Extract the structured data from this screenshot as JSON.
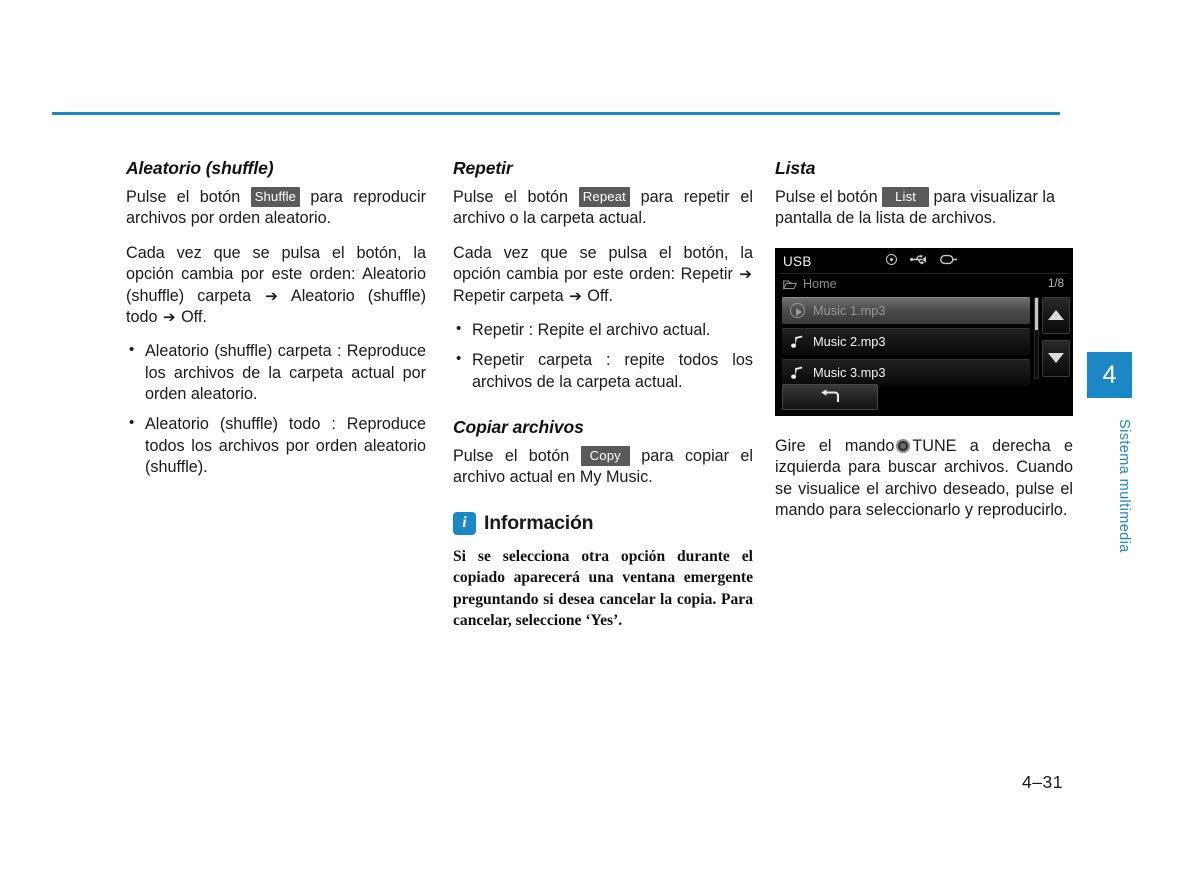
{
  "colors": {
    "accent": "#1b87c4",
    "badge_bg": "#5a5a5a",
    "device_bg": "#000000",
    "text": "#1a1a1a"
  },
  "page": {
    "number": "4–31",
    "chapter_tab_number": "4",
    "chapter_tab_label": "Sistema multimedia"
  },
  "col1": {
    "title": "Aleatorio (shuffle)",
    "p1_before": "Pulse el botón",
    "p1_badge": "Shuffle",
    "p1_after": "para reproducir archivos por orden aleatorio.",
    "p2_a": "Cada vez que se pulsa el botón, la opción cambia por este orden: Aleatorio (shuffle) carpeta",
    "p2_arrow1": "➔",
    "p2_b": "Aleatorio (shuffle) todo",
    "p2_arrow2": "➔",
    "p2_c": "Off.",
    "bullets": [
      "Aleatorio (shuffle) carpeta : Reproduce los archivos de la carpeta actual por orden aleatorio.",
      "Aleatorio (shuffle) todo : Reproduce todos los archivos por orden aleatorio (shuffle)."
    ]
  },
  "col2": {
    "title": "Repetir",
    "p1_before": "Pulse el botón",
    "p1_badge": "Repeat",
    "p1_after": "para repetir el archivo o la carpeta actual.",
    "p2_a": "Cada vez que se pulsa el botón, la opción cambia por este orden: Repetir",
    "p2_arrow1": "➔",
    "p2_b": "Repetir carpeta",
    "p2_arrow2": "➔",
    "p2_c": "Off.",
    "bullets": [
      "Repetir : Repite el archivo actual.",
      "Repetir carpeta : repite todos los archivos de la carpeta actual."
    ],
    "copy_title": "Copiar archivos",
    "copy_p_before": "Pulse el botón",
    "copy_p_badge": "Copy",
    "copy_p_after": "para copiar el archivo actual en My Music.",
    "info_icon": "info-i-icon",
    "info_title": "Información",
    "info_text": "Si se selecciona otra opción durante el copiado aparecerá una ventana emergente preguntando si desea cancelar la copia. Para cancelar, seleccione ‘Yes’."
  },
  "col3": {
    "title": "Lista",
    "p1_before": "Pulse el botón",
    "p1_badge": "List",
    "p1_after": "para visualizar la pantalla de la lista de archivos.",
    "device": {
      "source_label": "USB",
      "status_icons": [
        "disc-icon",
        "usb-trident-icon",
        "usb-plug-icon"
      ],
      "breadcrumb_icon": "folder-icon",
      "breadcrumb_label": "Home",
      "page_count": "1/8",
      "rows": [
        {
          "label": "Music 1.mp3",
          "icon": "play-circle-icon",
          "selected": true
        },
        {
          "label": "Music 2.mp3",
          "icon": "music-note-icon",
          "selected": false
        },
        {
          "label": "Music 3.mp3",
          "icon": "music-note-icon",
          "selected": false
        }
      ],
      "scroll_up_icon": "triangle-up-icon",
      "scroll_down_icon": "triangle-down-icon",
      "back_icon": "back-arrow-icon"
    },
    "tune_p_a": "Gire el mando",
    "tune_knob_icon": "tune-knob-icon",
    "tune_p_b": "TUNE a derecha e izquierda para buscar archivos. Cuando se visualice el archivo deseado, pulse el mando para seleccionarlo y reproducirlo."
  }
}
